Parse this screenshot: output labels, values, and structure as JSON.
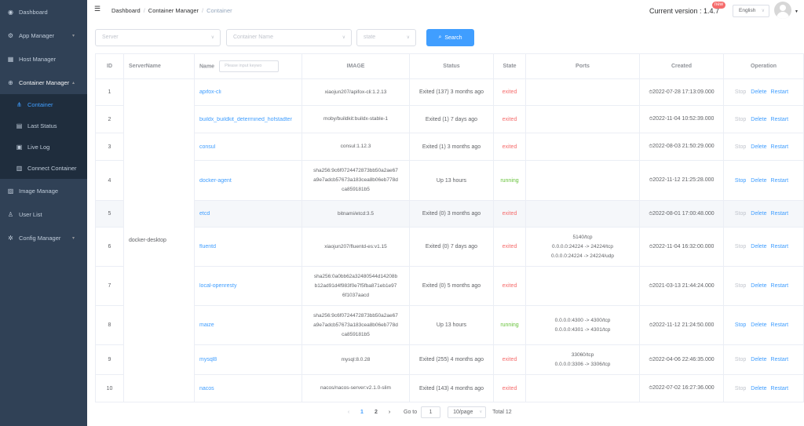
{
  "sidebar": {
    "items": [
      {
        "label": "Dashboard",
        "icon": "dashboard-icon"
      },
      {
        "label": "App Manager",
        "icon": "app-icon"
      },
      {
        "label": "Host Manager",
        "icon": "host-icon"
      },
      {
        "label": "Container Manager",
        "icon": "container-icon"
      },
      {
        "label": "Image Manage",
        "icon": "image-icon"
      },
      {
        "label": "User List",
        "icon": "user-icon"
      },
      {
        "label": "Config Manager",
        "icon": "config-icon"
      }
    ],
    "sub_items": [
      {
        "label": "Container"
      },
      {
        "label": "Last Status"
      },
      {
        "label": "Live Log"
      },
      {
        "label": "Connect Container"
      }
    ]
  },
  "navbar": {
    "breadcrumb": [
      "Dashboard",
      "Container Manager",
      "Container"
    ],
    "version_label": "Current version : 1.4.7",
    "new_badge": "new",
    "language": "English"
  },
  "filters": {
    "server_placeholder": "Server",
    "container_name_placeholder": "Container Name",
    "state_placeholder": "state",
    "search_label": "Search"
  },
  "table": {
    "headers": {
      "id": "ID",
      "server": "ServerName",
      "name": "Name",
      "name_input_placeholder": "Please input keywo",
      "image": "IMAGE",
      "status": "Status",
      "state": "State",
      "ports": "Ports",
      "created": "Created",
      "operation": "Operation"
    },
    "server_name": "docker-desktop",
    "ops": {
      "stop": "Stop",
      "delete": "Delete",
      "restart": "Restart"
    },
    "rows": [
      {
        "id": "1",
        "name": "apifox-cli",
        "image": [
          "xiaojun207/apifox-cli:1.2.13"
        ],
        "status": "Exited (137) 3 months ago",
        "state": "exited",
        "ports": [],
        "created": "2022-07-28 17:13:09.000"
      },
      {
        "id": "2",
        "name": "buildx_buildkit_determined_hofstadter",
        "image": [
          "moby/buildkit:buildx-stable-1"
        ],
        "status": "Exited (1) 7 days ago",
        "state": "exited",
        "ports": [],
        "created": "2022-11-04 10:52:39.000"
      },
      {
        "id": "3",
        "name": "consul",
        "image": [
          "consul:1.12.3"
        ],
        "status": "Exited (1) 3 months ago",
        "state": "exited",
        "ports": [],
        "created": "2022-08-03 21:50:29.000"
      },
      {
        "id": "4",
        "name": "docker-agent",
        "image": [
          "sha256:9c6f0724472873bb50a2ae67",
          "a9e7adcb57673a183cea8b06eb778d",
          "ca859181b5"
        ],
        "status": "Up 13 hours",
        "state": "running",
        "ports": [],
        "created": "2022-11-12 21:25:28.000"
      },
      {
        "id": "5",
        "name": "etcd",
        "image": [
          "bitnami/etcd:3.5"
        ],
        "status": "Exited (0) 3 months ago",
        "state": "exited",
        "ports": [],
        "created": "2022-08-01 17:00:48.000"
      },
      {
        "id": "6",
        "name": "fluentd",
        "image": [
          "xiaojun207/fluentd-es:v1.15"
        ],
        "status": "Exited (0) 7 days ago",
        "state": "exited",
        "ports": [
          "5140/tcp",
          "0.0.0.0:24224 -> 24224/tcp",
          "0.0.0.0:24224 -> 24224/udp"
        ],
        "created": "2022-11-04 16:32:00.000"
      },
      {
        "id": "7",
        "name": "local-openresty",
        "image": [
          "sha256:0a0bb62a32480544d14208b",
          "b12ad91d4f983f0e7f5fba871eb1e97",
          "6f1037aacd"
        ],
        "status": "Exited (0) 5 months ago",
        "state": "exited",
        "ports": [],
        "created": "2021-03-13 21:44:24.000"
      },
      {
        "id": "8",
        "name": "maize",
        "image": [
          "sha256:9c6f0724472873bb50a2ae67",
          "a9e7adcb57673a183cea8b06eb778d",
          "ca859181b5"
        ],
        "status": "Up 13 hours",
        "state": "running",
        "ports": [
          "0.0.0.0:4300 -> 4300/tcp",
          "0.0.0.0:4301 -> 4301/tcp"
        ],
        "created": "2022-11-12 21:24:50.000"
      },
      {
        "id": "9",
        "name": "mysql8",
        "image": [
          "mysql:8.0.28"
        ],
        "status": "Exited (255) 4 months ago",
        "state": "exited",
        "ports": [
          "33060/tcp",
          "0.0.0.0:3306 -> 3306/tcp"
        ],
        "created": "2022-04-06 22:46:35.000"
      },
      {
        "id": "10",
        "name": "nacos",
        "image": [
          "nacos/nacos-server:v2.1.0-slim"
        ],
        "status": "Exited (143) 4 months ago",
        "state": "exited",
        "ports": [],
        "created": "2022-07-02 16:27:36.000"
      }
    ]
  },
  "pagination": {
    "pages": [
      "1",
      "2"
    ],
    "current": "1",
    "goto_label": "Go to",
    "goto_value": "1",
    "page_size": "10/page",
    "total": "Total 12"
  },
  "colors": {
    "sidebar": "#304156",
    "submenu": "#1f2d3d",
    "primary": "#409eff",
    "exited": "#f56c6c",
    "running": "#67c23a"
  }
}
